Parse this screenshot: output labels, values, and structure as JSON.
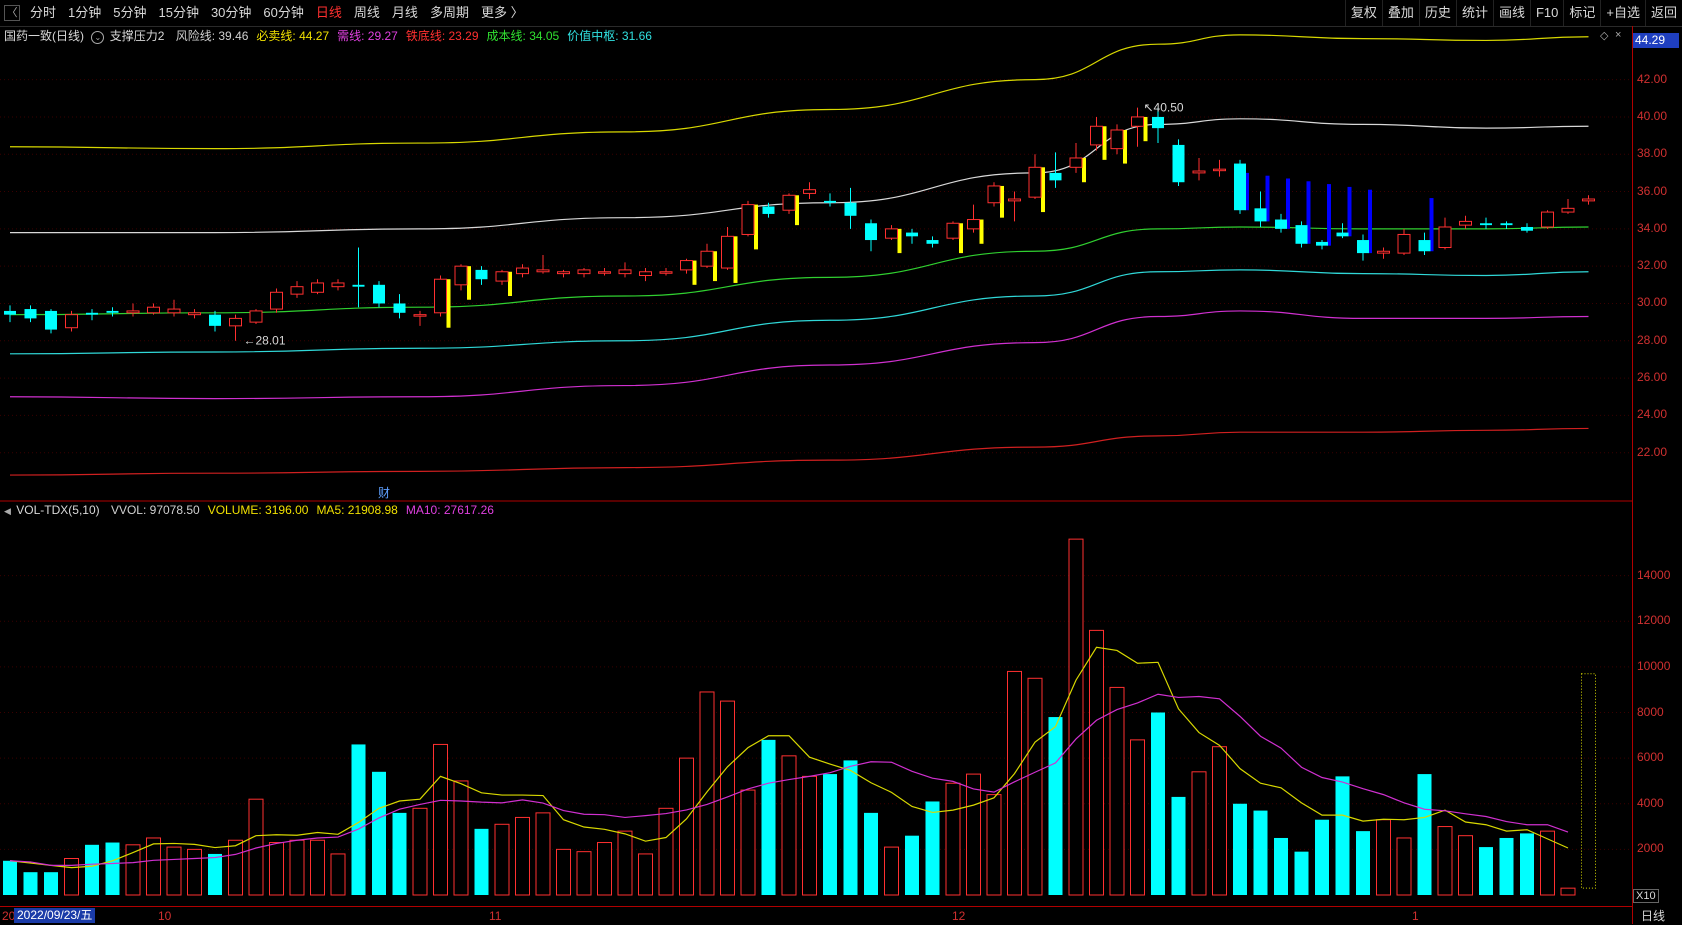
{
  "toolbar": {
    "left_items": [
      "分时",
      "1分钟",
      "5分钟",
      "15分钟",
      "30分钟",
      "60分钟",
      "日线",
      "周线",
      "月线",
      "多周期",
      "更多 〉"
    ],
    "active": "日线",
    "right_items": [
      "复权",
      "叠加",
      "历史",
      "统计",
      "画线",
      "F10",
      "标记",
      "+自选",
      "返回"
    ]
  },
  "price_info": {
    "stock": "国药一致(日线)",
    "indicator": "支撑压力2",
    "items": [
      {
        "label": "风险线: 39.46",
        "color": "#d0d0d0"
      },
      {
        "label": "必卖线: 44.27",
        "color": "#f0e000"
      },
      {
        "label": "需线: 29.27",
        "color": "#e040e0"
      },
      {
        "label": "铁底线: 23.29",
        "color": "#ff3030"
      },
      {
        "label": "成本线: 34.05",
        "color": "#30e030"
      },
      {
        "label": "价值中枢: 31.66",
        "color": "#30e0e0"
      }
    ]
  },
  "volume_info": {
    "name": "VOL-TDX(5,10)",
    "items": [
      {
        "label": "VVOL: 97078.50",
        "color": "#d0d0d0"
      },
      {
        "label": "VOLUME: 3196.00",
        "color": "#f0e000"
      },
      {
        "label": "MA5: 21908.98",
        "color": "#f0e000"
      },
      {
        "label": "MA10: 27617.26",
        "color": "#e040e0"
      }
    ]
  },
  "price_axis": {
    "ticks": [
      "42.00",
      "40.00",
      "38.00",
      "36.00",
      "34.00",
      "32.00",
      "30.00",
      "28.00",
      "26.00",
      "24.00",
      "22.00"
    ],
    "current": "44.29"
  },
  "volume_axis": {
    "ticks": [
      "14000",
      "12000",
      "10000",
      "8000",
      "6000",
      "4000",
      "2000"
    ],
    "unit": "X10"
  },
  "date_axis": {
    "selected": "2022/09/23/五",
    "prefix": "20",
    "months": [
      "10",
      "11",
      "12",
      "1"
    ]
  },
  "annotations": {
    "high_label": "40.50",
    "low_label": "28.01",
    "fin_mark": "财"
  },
  "bottom_right_label": "日线",
  "colors": {
    "up": "#ff3030",
    "down": "#00ffff",
    "bull_bar": "#ffff00",
    "bear_bar": "#0000ff",
    "axis": "#b00000"
  },
  "chart_data": {
    "type": "candlestick",
    "candles": [
      {
        "o": 29.6,
        "c": 29.4,
        "h": 29.9,
        "l": 29.0
      },
      {
        "o": 29.7,
        "c": 29.2,
        "h": 29.9,
        "l": 29.0
      },
      {
        "o": 29.6,
        "c": 28.6,
        "h": 29.7,
        "l": 28.4
      },
      {
        "o": 28.7,
        "c": 29.4,
        "h": 29.6,
        "l": 28.5
      },
      {
        "o": 29.5,
        "c": 29.4,
        "h": 29.7,
        "l": 29.1
      },
      {
        "o": 29.6,
        "c": 29.5,
        "h": 29.8,
        "l": 29.3
      },
      {
        "o": 29.5,
        "c": 29.6,
        "h": 30.0,
        "l": 29.3
      },
      {
        "o": 29.5,
        "c": 29.8,
        "h": 30.0,
        "l": 29.4
      },
      {
        "o": 29.5,
        "c": 29.7,
        "h": 30.2,
        "l": 29.3
      },
      {
        "o": 29.4,
        "c": 29.5,
        "h": 29.7,
        "l": 29.2
      },
      {
        "o": 29.4,
        "c": 28.8,
        "h": 29.6,
        "l": 28.5
      },
      {
        "o": 28.8,
        "c": 29.2,
        "h": 29.4,
        "l": 28.0
      },
      {
        "o": 29.0,
        "c": 29.6,
        "h": 29.7,
        "l": 28.9
      },
      {
        "o": 29.7,
        "c": 30.6,
        "h": 30.8,
        "l": 29.5
      },
      {
        "o": 30.5,
        "c": 30.9,
        "h": 31.2,
        "l": 30.3
      },
      {
        "o": 30.6,
        "c": 31.1,
        "h": 31.3,
        "l": 30.5
      },
      {
        "o": 30.9,
        "c": 31.1,
        "h": 31.3,
        "l": 30.7
      },
      {
        "o": 31.0,
        "c": 30.9,
        "h": 33.0,
        "l": 29.8
      },
      {
        "o": 31.0,
        "c": 30.0,
        "h": 31.2,
        "l": 29.8
      },
      {
        "o": 30.0,
        "c": 29.5,
        "h": 30.5,
        "l": 29.2
      },
      {
        "o": 29.4,
        "c": 29.4,
        "h": 29.6,
        "l": 28.8
      },
      {
        "o": 29.5,
        "c": 31.3,
        "h": 31.5,
        "l": 29.3
      },
      {
        "o": 31.0,
        "c": 32.0,
        "h": 32.1,
        "l": 30.7
      },
      {
        "o": 31.8,
        "c": 31.3,
        "h": 32.0,
        "l": 31.0
      },
      {
        "o": 31.2,
        "c": 31.7,
        "h": 31.8,
        "l": 31.0
      },
      {
        "o": 31.6,
        "c": 31.9,
        "h": 32.1,
        "l": 31.4
      },
      {
        "o": 31.7,
        "c": 31.8,
        "h": 32.6,
        "l": 31.6
      },
      {
        "o": 31.6,
        "c": 31.7,
        "h": 31.8,
        "l": 31.4
      },
      {
        "o": 31.6,
        "c": 31.8,
        "h": 31.9,
        "l": 31.4
      },
      {
        "o": 31.7,
        "c": 31.7,
        "h": 31.9,
        "l": 31.5
      },
      {
        "o": 31.6,
        "c": 31.8,
        "h": 32.2,
        "l": 31.4
      },
      {
        "o": 31.5,
        "c": 31.7,
        "h": 31.9,
        "l": 31.2
      },
      {
        "o": 31.7,
        "c": 31.7,
        "h": 31.9,
        "l": 31.5
      },
      {
        "o": 31.8,
        "c": 32.3,
        "h": 32.4,
        "l": 31.6
      },
      {
        "o": 32.0,
        "c": 32.8,
        "h": 33.2,
        "l": 31.9
      },
      {
        "o": 31.9,
        "c": 33.6,
        "h": 34.1,
        "l": 31.8
      },
      {
        "o": 33.7,
        "c": 35.3,
        "h": 35.5,
        "l": 33.6
      },
      {
        "o": 35.2,
        "c": 34.8,
        "h": 35.4,
        "l": 34.6
      },
      {
        "o": 35.0,
        "c": 35.8,
        "h": 35.9,
        "l": 34.8
      },
      {
        "o": 35.9,
        "c": 36.1,
        "h": 36.5,
        "l": 35.6
      },
      {
        "o": 35.5,
        "c": 35.4,
        "h": 35.9,
        "l": 35.2
      },
      {
        "o": 35.4,
        "c": 34.7,
        "h": 36.2,
        "l": 34.0
      },
      {
        "o": 34.3,
        "c": 33.4,
        "h": 34.5,
        "l": 32.8
      },
      {
        "o": 33.5,
        "c": 34.0,
        "h": 34.2,
        "l": 33.4
      },
      {
        "o": 33.8,
        "c": 33.6,
        "h": 34.0,
        "l": 33.2
      },
      {
        "o": 33.4,
        "c": 33.2,
        "h": 33.6,
        "l": 33.0
      },
      {
        "o": 33.5,
        "c": 34.3,
        "h": 34.4,
        "l": 33.4
      },
      {
        "o": 34.0,
        "c": 34.5,
        "h": 35.3,
        "l": 33.8
      },
      {
        "o": 35.4,
        "c": 36.3,
        "h": 36.5,
        "l": 35.2
      },
      {
        "o": 35.5,
        "c": 35.6,
        "h": 36.0,
        "l": 34.4
      },
      {
        "o": 35.7,
        "c": 37.3,
        "h": 38.0,
        "l": 35.6
      },
      {
        "o": 37.0,
        "c": 36.6,
        "h": 38.1,
        "l": 36.2
      },
      {
        "o": 37.3,
        "c": 37.8,
        "h": 38.6,
        "l": 37.0
      },
      {
        "o": 38.5,
        "c": 39.5,
        "h": 40.0,
        "l": 38.2
      },
      {
        "o": 38.3,
        "c": 39.3,
        "h": 39.6,
        "l": 38.0
      },
      {
        "o": 39.5,
        "c": 40.0,
        "h": 40.5,
        "l": 38.4
      },
      {
        "o": 40.0,
        "c": 39.4,
        "h": 40.5,
        "l": 38.6
      },
      {
        "o": 38.5,
        "c": 36.5,
        "h": 38.8,
        "l": 36.3
      },
      {
        "o": 37.0,
        "c": 37.1,
        "h": 37.8,
        "l": 36.6
      },
      {
        "o": 37.2,
        "c": 37.2,
        "h": 37.7,
        "l": 36.8
      },
      {
        "o": 37.5,
        "c": 35.0,
        "h": 37.7,
        "l": 34.8
      },
      {
        "o": 35.1,
        "c": 34.4,
        "h": 36.0,
        "l": 34.1
      },
      {
        "o": 34.5,
        "c": 34.0,
        "h": 34.8,
        "l": 33.8
      },
      {
        "o": 34.2,
        "c": 33.2,
        "h": 34.4,
        "l": 33.0
      },
      {
        "o": 33.3,
        "c": 33.1,
        "h": 33.4,
        "l": 32.9
      },
      {
        "o": 33.8,
        "c": 33.6,
        "h": 34.3,
        "l": 33.5
      },
      {
        "o": 33.4,
        "c": 32.7,
        "h": 33.7,
        "l": 32.3
      },
      {
        "o": 32.7,
        "c": 32.8,
        "h": 33.0,
        "l": 32.4
      },
      {
        "o": 32.7,
        "c": 33.7,
        "h": 34.0,
        "l": 32.6
      },
      {
        "o": 33.4,
        "c": 32.8,
        "h": 33.8,
        "l": 32.6
      },
      {
        "o": 33.0,
        "c": 34.1,
        "h": 34.6,
        "l": 32.9
      },
      {
        "o": 34.2,
        "c": 34.4,
        "h": 34.7,
        "l": 34.0
      },
      {
        "o": 34.3,
        "c": 34.2,
        "h": 34.6,
        "l": 34.0
      },
      {
        "o": 34.3,
        "c": 34.2,
        "h": 34.4,
        "l": 34.0
      },
      {
        "o": 34.1,
        "c": 33.9,
        "h": 34.3,
        "l": 33.8
      },
      {
        "o": 34.1,
        "c": 34.9,
        "h": 35.0,
        "l": 34.0
      },
      {
        "o": 34.9,
        "c": 35.1,
        "h": 35.6,
        "l": 34.8
      },
      {
        "o": 35.5,
        "c": 35.6,
        "h": 35.8,
        "l": 35.3
      }
    ],
    "volume": [
      1500,
      1000,
      1000,
      1600,
      2200,
      2300,
      2200,
      2500,
      2100,
      2000,
      1800,
      2400,
      4200,
      2300,
      2400,
      2400,
      1800,
      6600,
      5400,
      3600,
      3800,
      6600,
      5000,
      2900,
      3100,
      3400,
      3600,
      2000,
      1900,
      2300,
      2800,
      1800,
      3800,
      6000,
      8900,
      8500,
      4600,
      6800,
      6100,
      5200,
      5300,
      5900,
      3600,
      2100,
      2600,
      4100,
      4900,
      5300,
      4400,
      9800,
      9500,
      7800,
      15600,
      11600,
      9100,
      6800,
      8000,
      4300,
      5400,
      6500,
      4000,
      3700,
      2500,
      1900,
      3300,
      5200,
      2800,
      3300,
      2500,
      5300,
      3000,
      2600,
      2100,
      2500,
      2700,
      2800,
      300
    ],
    "ma5": [
      1500,
      1400,
      1300,
      1200,
      1260,
      1500,
      1860,
      2240,
      2260,
      2220,
      2080,
      2160,
      2600,
      2640,
      2620,
      2740,
      2660,
      3180,
      3800,
      4120,
      4200,
      5200,
      4880,
      4480,
      4380,
      4380,
      4360,
      3300,
      2980,
      2880,
      2680,
      2360,
      2520,
      3340,
      4520,
      5620,
      6460,
      6980,
      6980,
      6040,
      5740,
      5460,
      4920,
      4500,
      3880,
      3620,
      3720,
      3940,
      4260,
      5320,
      6700,
      7380,
      9420,
      10860,
      10720,
      10160,
      10200,
      8160,
      7120,
      6560,
      5540,
      4900,
      4700,
      4040,
      3500,
      3500,
      3240,
      3320,
      3300,
      3400,
      3720,
      3200,
      3080,
      2800,
      2860,
      2460,
      2060
    ],
    "ma10": [
      1500,
      1450,
      1300,
      1300,
      1350,
      1380,
      1420,
      1520,
      1560,
      1600,
      1640,
      1780,
      2060,
      2260,
      2400,
      2500,
      2540,
      2890,
      3380,
      3760,
      3970,
      4150,
      4120,
      4070,
      4040,
      4170,
      4030,
      3700,
      3540,
      3520,
      3400,
      3480,
      3570,
      3730,
      3970,
      4300,
      4650,
      4900,
      5060,
      5200,
      5360,
      5640,
      5840,
      5820,
      5420,
      5120,
      4980,
      4650,
      4510,
      4960,
      5380,
      5790,
      6840,
      7660,
      8130,
      8420,
      8800,
      8660,
      8700,
      8600,
      7830,
      6960,
      6440,
      5600,
      5150,
      4950,
      4660,
      4400,
      4040,
      3760,
      3690,
      3560,
      3440,
      3220,
      3080,
      3080,
      2760
    ],
    "lines": {
      "risk": [
        [
          0,
          33.8
        ],
        [
          10,
          33.8
        ],
        [
          20,
          34.0
        ],
        [
          30,
          34.6
        ],
        [
          40,
          35.4
        ],
        [
          50,
          37.0
        ],
        [
          56,
          39.6
        ],
        [
          60,
          39.9
        ],
        [
          66,
          39.6
        ],
        [
          72,
          39.4
        ],
        [
          77,
          39.5
        ]
      ],
      "sell": [
        [
          0,
          38.4
        ],
        [
          10,
          38.3
        ],
        [
          20,
          38.6
        ],
        [
          30,
          39.2
        ],
        [
          40,
          40.4
        ],
        [
          50,
          42.0
        ],
        [
          56,
          43.9
        ],
        [
          60,
          44.4
        ],
        [
          66,
          44.2
        ],
        [
          72,
          44.1
        ],
        [
          77,
          44.3
        ]
      ],
      "cost": [
        [
          0,
          29.4
        ],
        [
          10,
          29.5
        ],
        [
          20,
          29.8
        ],
        [
          30,
          30.4
        ],
        [
          40,
          31.4
        ],
        [
          50,
          32.8
        ],
        [
          56,
          34.0
        ],
        [
          60,
          34.1
        ],
        [
          66,
          34.0
        ],
        [
          72,
          34.0
        ],
        [
          77,
          34.1
        ]
      ],
      "value": [
        [
          0,
          27.3
        ],
        [
          10,
          27.4
        ],
        [
          20,
          27.6
        ],
        [
          30,
          28.0
        ],
        [
          40,
          29.1
        ],
        [
          50,
          30.4
        ],
        [
          56,
          31.7
        ],
        [
          60,
          31.8
        ],
        [
          66,
          31.6
        ],
        [
          72,
          31.5
        ],
        [
          77,
          31.7
        ]
      ],
      "need": [
        [
          0,
          25.0
        ],
        [
          10,
          24.9
        ],
        [
          20,
          25.0
        ],
        [
          30,
          25.6
        ],
        [
          40,
          26.7
        ],
        [
          50,
          27.9
        ],
        [
          56,
          29.3
        ],
        [
          60,
          29.6
        ],
        [
          66,
          29.2
        ],
        [
          72,
          29.2
        ],
        [
          77,
          29.3
        ]
      ],
      "iron": [
        [
          0,
          20.8
        ],
        [
          10,
          20.9
        ],
        [
          20,
          21.0
        ],
        [
          30,
          21.2
        ],
        [
          40,
          21.6
        ],
        [
          50,
          22.3
        ],
        [
          56,
          22.9
        ],
        [
          60,
          23.1
        ],
        [
          66,
          23.1
        ],
        [
          72,
          23.2
        ],
        [
          77,
          23.3
        ]
      ]
    }
  }
}
